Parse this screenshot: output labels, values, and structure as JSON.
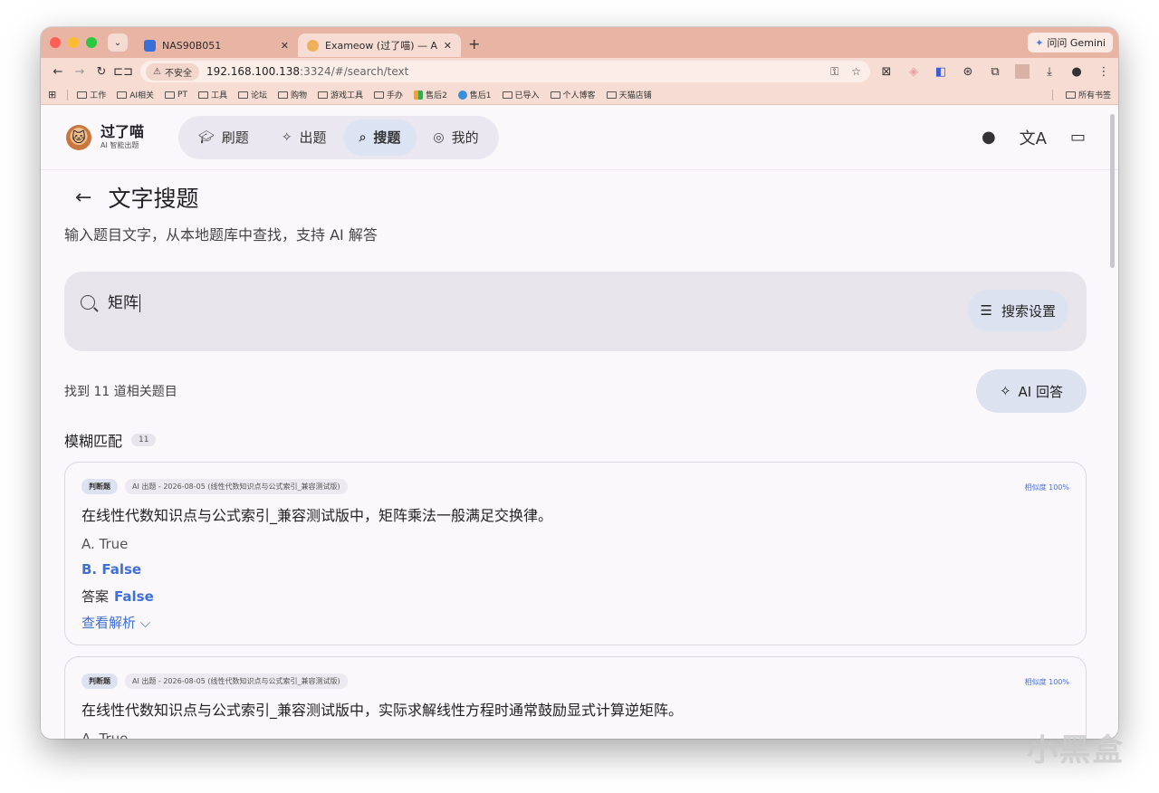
{
  "browser": {
    "tabs": [
      {
        "title": "NAS90B051",
        "active": false
      },
      {
        "title": "Exameow (过了喵) — AI Exam",
        "active": true
      }
    ],
    "gemini_label": "问问 Gemini",
    "insecure_label": "不安全",
    "url_host": "192.168.100.138",
    "url_rest": ":3324/#/search/text",
    "bookmarks": [
      "工作",
      "AI相关",
      "PT",
      "工具",
      "论坛",
      "购物",
      "游戏工具",
      "手办",
      "售后2",
      "售后1",
      "已导入",
      "个人博客",
      "天猫店铺"
    ],
    "all_bookmarks_label": "所有书签"
  },
  "app": {
    "brand_name": "过了喵",
    "brand_sub": "AI 智能出题",
    "nav": [
      {
        "label": "刷题",
        "icon": "graduation-cap-icon"
      },
      {
        "label": "出题",
        "icon": "sparkle-icon"
      },
      {
        "label": "搜题",
        "icon": "search-icon",
        "active": true
      },
      {
        "label": "我的",
        "icon": "user-circle-icon"
      }
    ]
  },
  "page": {
    "title": "文字搜题",
    "subtitle": "输入题目文字，从本地题库中查找，支持 AI 解答",
    "search_value": "矩阵",
    "search_settings_label": "搜索设置",
    "results_count": "找到 11 道相关题目",
    "ai_answer_label": "AI 回答",
    "section_title": "模糊匹配",
    "section_count": "11"
  },
  "results": [
    {
      "type": "判断题",
      "source": "AI 出题 - 2026-08-05 (线性代数知识点与公式索引_兼容测试版)",
      "similarity": "相似度 100%",
      "question": "在线性代数知识点与公式索引_兼容测试版中，矩阵乘法一般满足交换律。",
      "options": [
        "A.  True",
        "B.  False"
      ],
      "answer_label": "答案",
      "answer": "False",
      "explain_label": "查看解析"
    },
    {
      "type": "判断题",
      "source": "AI 出题 - 2026-08-05 (线性代数知识点与公式索引_兼容测试版)",
      "similarity": "相似度 100%",
      "question": "在线性代数知识点与公式索引_兼容测试版中，实际求解线性方程时通常鼓励显式计算逆矩阵。",
      "options": [
        "A.  True"
      ]
    }
  ],
  "watermark": "小黑盒",
  "colors": {
    "accent": "#3f6fd9",
    "tabstrip": "#e8b4a4",
    "search_bg": "#e7e4ec"
  }
}
